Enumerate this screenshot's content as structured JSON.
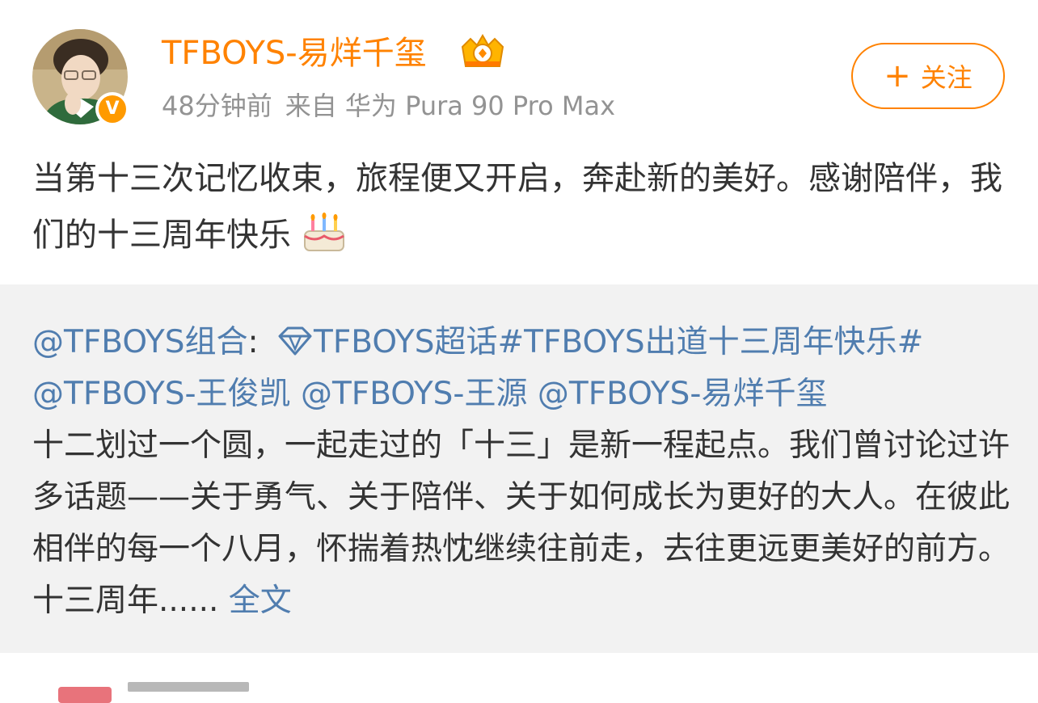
{
  "author": {
    "name": "TFBOYS-易烊千玺",
    "verified_badge": "V",
    "time": "48分钟前",
    "source": "来自 华为 Pura 90 Pro Max"
  },
  "follow": {
    "plus": "+",
    "label": "关注"
  },
  "post": {
    "text": "当第十三次记忆收束，旅程便又开启，奔赴新的美好。感谢陪伴，我们的十三周年快乐",
    "emoji": "cake-icon"
  },
  "repost": {
    "origin_user": "@TFBOYS组合",
    "colon": ": ",
    "supertopic": "TFBOYS超话",
    "hashtag": "#TFBOYS出道十三周年快乐#",
    "mentions": [
      "@TFBOYS-王俊凯",
      "@TFBOYS-王源",
      "@TFBOYS-易烊千玺"
    ],
    "body": "十二划过一个圆，一起走过的「十三」是新一程起点。我们曾讨论过许多话题——关于勇气、关于陪伴、关于如何成长为更好的大人。在彼此相伴的每一个八月，怀揣着热忱继续往前走，去往更远更美好的前方。十三周年......",
    "full_text_link": "全文"
  },
  "colors": {
    "username": "#ff8200",
    "link": "#507daf",
    "meta": "#939393",
    "repost_bg": "#f2f2f2"
  }
}
